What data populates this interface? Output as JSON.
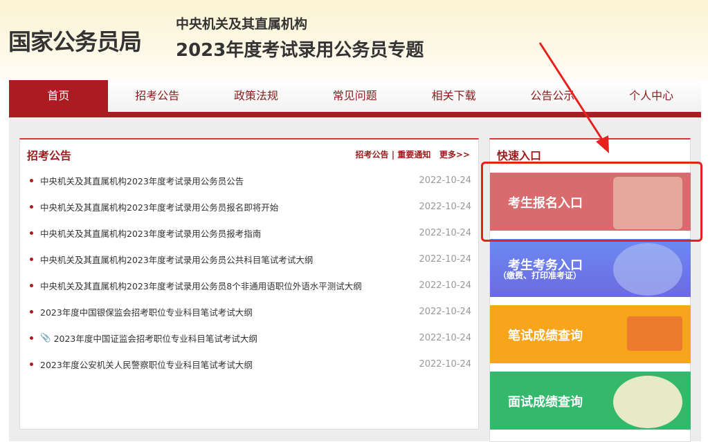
{
  "header": {
    "logo": "国家公务员局",
    "subtitle1": "中央机关及其直属机构",
    "subtitle2": "2023年度考试录用公务员专题"
  },
  "nav": [
    "首页",
    "招考公告",
    "政策法规",
    "常见问题",
    "相关下载",
    "公告公示",
    "个人中心"
  ],
  "announcements": {
    "title": "招考公告",
    "link1": "招考公告",
    "sep": "|",
    "link2": "重要通知",
    "more": "更多>>",
    "items": [
      {
        "title": "中央机关及其直属机构2023年度考试录用公务员公告",
        "date": "2022-10-24"
      },
      {
        "title": "中央机关及其直属机构2023年度考试录用公务员报名即将开始",
        "date": "2022-10-24"
      },
      {
        "title": "中央机关及其直属机构2023年度考试录用公务员报考指南",
        "date": "2022-10-24"
      },
      {
        "title": "中央机关及其直属机构2023年度考试录用公务员公共科目笔试考试大纲",
        "date": "2022-10-24"
      },
      {
        "title": "中央机关及其直属机构2023年度考试录用公务员8个非通用语职位外语水平测试大纲",
        "date": "2022-10-24"
      },
      {
        "title": "2023年度中国银保监会招考职位专业科目笔试考试大纲",
        "date": "2022-10-24"
      },
      {
        "title": "2023年度中国证监会招考职位专业科目笔试考试大纲",
        "date": "2022-10-24",
        "attachment": true
      },
      {
        "title": "2023年度公安机关人民警察职位专业科目笔试考试大纲",
        "date": "2022-10-24"
      }
    ]
  },
  "quick": {
    "title": "快速入口",
    "cards": [
      {
        "label": "考生报名入口",
        "color": "#d86b6e"
      },
      {
        "label": "考生考务入口",
        "sub": "（缴费、打印准考证）",
        "color": "#6a7ae8"
      },
      {
        "label": "笔试成绩查询",
        "color": "#f7a61c"
      },
      {
        "label": "面试成绩查询",
        "color": "#33b86c"
      }
    ]
  },
  "annotation_color": "#e8201c"
}
